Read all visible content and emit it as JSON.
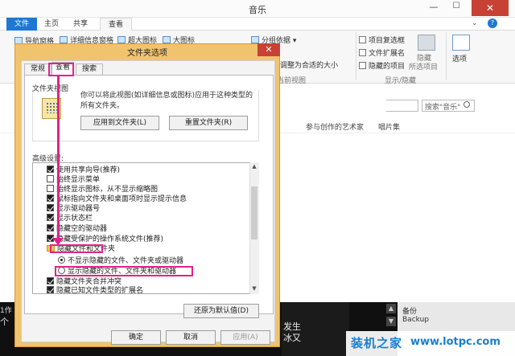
{
  "explorer": {
    "title": "音乐",
    "tabs": [
      "文件",
      "主页",
      "共享",
      "查看"
    ],
    "ribbon": {
      "nav_pane": "导航窗格",
      "details_pane": "详细信息窗格",
      "extra_large_icons": "超大图标",
      "large_icons": "大图标",
      "group_by": "分组依据",
      "fit_columns": "将所有列调整为合适的大小",
      "group_view": "当前视图",
      "item_checkboxes": "项目复选框",
      "file_extensions": "文件扩展名",
      "hidden_items": "隐藏的项目",
      "hide_selected": "隐藏",
      "selected_items": "所选项目",
      "options": "选项",
      "group_show_hide": "显示/隐藏"
    },
    "search_placeholder": "搜索\"音乐\"",
    "columns": {
      "artists": "参与创作的艺术家",
      "album": "唱片集"
    },
    "bottom": {
      "left_top": "1作",
      "left_mid": "个",
      "middle_1": "发生",
      "middle_2": "冰又",
      "right_1": "备份",
      "right_2": "Backup"
    }
  },
  "dialog": {
    "title": "文件夹选项",
    "tabs": [
      "常规",
      "查看",
      "搜索"
    ],
    "folder_views_label": "文件夹视图",
    "folder_views_desc": "你可以将此视图(如详细信息或图标)应用于这种类型的所有文件夹。",
    "apply_to_folders": "应用到文件夹(L)",
    "reset_folders": "重置文件夹(R)",
    "advanced_label": "高级设置:",
    "advanced_items": [
      {
        "type": "check",
        "on": true,
        "label": "使用共享向导(推荐)"
      },
      {
        "type": "check",
        "on": false,
        "label": "始终显示菜单"
      },
      {
        "type": "check",
        "on": false,
        "label": "始终显示图标，从不显示缩略图"
      },
      {
        "type": "check",
        "on": true,
        "label": "鼠标指向文件夹和桌面项时显示提示信息"
      },
      {
        "type": "check",
        "on": true,
        "label": "显示驱动器号"
      },
      {
        "type": "check",
        "on": true,
        "label": "显示状态栏"
      },
      {
        "type": "check",
        "on": true,
        "label": "隐藏空的驱动器"
      },
      {
        "type": "check",
        "on": true,
        "label": "隐藏受保护的操作系统文件(推荐)"
      },
      {
        "type": "folder",
        "on": false,
        "label": "隐藏文件和文件夹"
      },
      {
        "type": "radio",
        "on": true,
        "label": "不显示隐藏的文件、文件夹或驱动器"
      },
      {
        "type": "radio",
        "on": false,
        "label": "显示隐藏的文件、文件夹和驱动器"
      },
      {
        "type": "check",
        "on": true,
        "label": "隐藏文件夹合并冲突"
      },
      {
        "type": "check",
        "on": true,
        "label": "隐藏已知文件类型的扩展名"
      }
    ],
    "restore_defaults": "还原为默认值(D)",
    "ok": "确定",
    "cancel": "取消",
    "apply": "应用(A)"
  },
  "watermark": {
    "cn": "装机之家",
    "url": "www.lotpc.com"
  },
  "colors": {
    "accent": "#1e78d2",
    "highlight": "#e0228a",
    "dialog_frame": "#f0c46e",
    "close": "#c74234"
  }
}
